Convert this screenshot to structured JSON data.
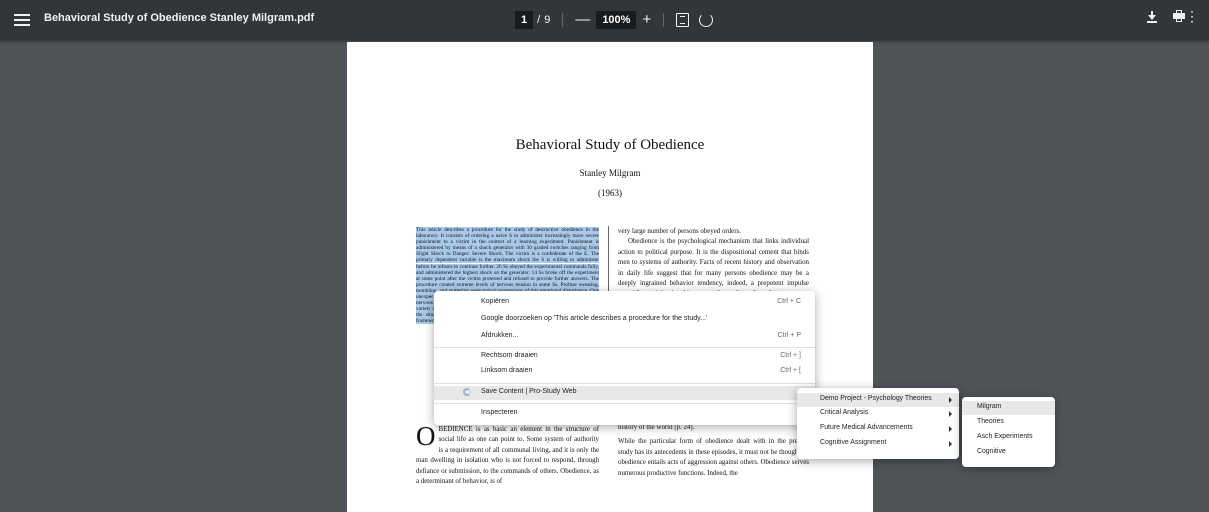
{
  "toolbar": {
    "title": "Behavioral Study of Obedience Stanley Milgram.pdf",
    "page_current": "1",
    "page_sep": "/",
    "page_total": "9",
    "zoom_out": "—",
    "zoom": "100%",
    "zoom_in": "+",
    "icons": [
      "menu-icon",
      "fit-page-icon",
      "rotate-icon",
      "download-icon",
      "print-icon",
      "more-icon"
    ]
  },
  "document": {
    "title": "Behavioral Study of Obedience",
    "author": "Stanley Milgram",
    "year": "(1963)",
    "abstract": "This article describes a procedure for the study of destructive obedience in the laboratory. It consists of ordering a naive S to administer increasingly more severe punishment to a victim in the context of a learning experiment. Punishment is administered by means of a shock generator with 30 graded switches ranging from Slight Shock to Danger: Severe Shock. The victim is a confederate of the E. The primary dependent variable is the maximum shock the S is willing to administer before he refuses to continue further. 26 Ss obeyed the experimental commands fully, and administered the highest shock on the generator. 14 Ss broke off the experiment at some point after the victim protested and refused to provide further answers. The procedure created extreme levels of nervous tension in some Ss. Profuse sweating, trembling, and stuttering were typical expressions of this emotional disturbance. One unexpected sign of tension—yet to be explained—was the regular occurrence of nervous laughter, which in some Ss developed into uncontrollable seizures. The variety of interesting behavioral dynamics observed in the experiment, the reality of the situation for the S, and the possibility of parametric variation within the framework of the procedure, point to the fruitfulness of further study.",
    "right_col_1": "very large number of persons obeyed orders.",
    "right_col_2": "Obedience is the psychological mechanism that links individual action to political purpose. It is the dispositional cement that binds men to systems of authority. Facts of recent history and observation in daily life suggest that for many persons obedience may be a deeply ingrained behavior tendency, indeed, a prepotent impulse overriding training in ethics, sympathy, and moral conduct.",
    "right_col_3": "history of the world [p. 24].",
    "right_col_4": "While the particular form of obedience dealt with in the present study has its antecedents in these episodes, it must not be thought all obedience entails acts of aggression against others. Obedience serves numerous productive functions. Indeed, the",
    "body_dropcap": "O",
    "body_left": "BEDIENCE is as basic an element in the structure of social life as one can point to. Some system of authority is a requirement of all communal living, and it is only the man dwelling in isolation who is not forced to respond, through defiance or submission, to the commands of others. Obedience, as a determinant of behavior, is of"
  },
  "context_menu": {
    "items": [
      {
        "label": "Kopiëren",
        "shortcut": "Ctrl + C"
      },
      {
        "label": "Google doorzoeken op 'This article describes a procedure for the study...'",
        "shortcut": ""
      },
      {
        "label": "Afdrukken...",
        "shortcut": "Ctrl + P"
      },
      {
        "label": "Rechtsom draaien",
        "shortcut": "Ctrl + ]"
      },
      {
        "label": "Linksom draaien",
        "shortcut": "Ctrl + ["
      },
      {
        "label": "Save Content | Pro-Study Web",
        "shortcut": ""
      },
      {
        "label": "Inspecteren",
        "shortcut": ""
      }
    ]
  },
  "submenu_projects": {
    "items": [
      "Demo Project - Psychology Theories",
      "Critical Analysis",
      "Future Medical Advancements",
      "Cognitive Assignment"
    ]
  },
  "submenu_folders": {
    "items": [
      "Milgram",
      "Theories",
      "Asch Experiments",
      "Cognitive"
    ]
  }
}
